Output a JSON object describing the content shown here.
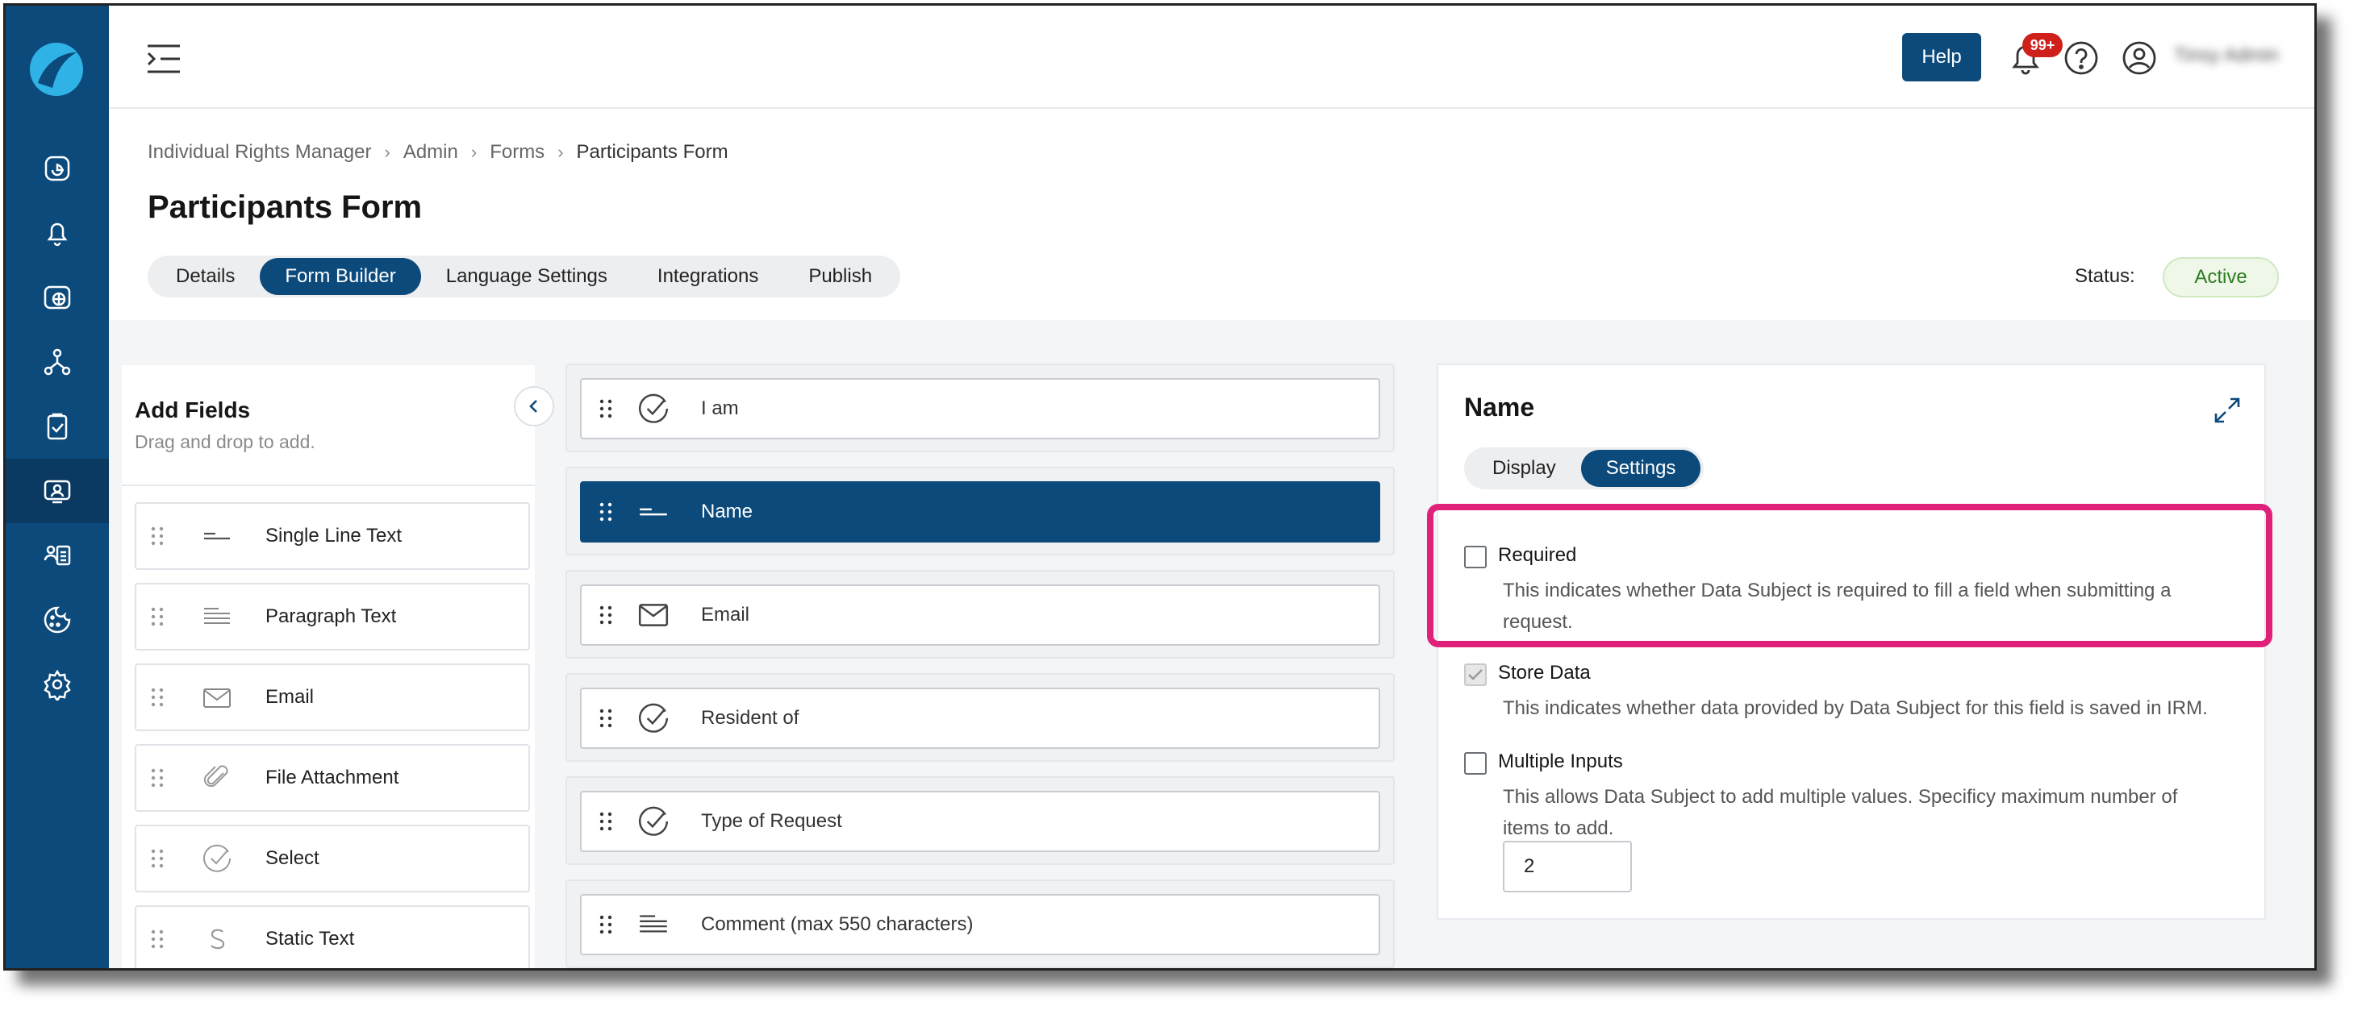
{
  "topbar": {
    "help_label": "Help",
    "notif_badge": "99+",
    "user_name": "Tinsy Admin"
  },
  "breadcrumb": [
    "Individual Rights Manager",
    "Admin",
    "Forms",
    "Participants Form"
  ],
  "page": {
    "title": "Participants Form",
    "tabs": [
      "Details",
      "Form Builder",
      "Language Settings",
      "Integrations",
      "Publish"
    ],
    "active_tab": "Form Builder",
    "status_label": "Status:",
    "status_value": "Active"
  },
  "add_fields": {
    "title": "Add Fields",
    "subtitle": "Drag and drop to add.",
    "items": [
      {
        "label": "Single Line Text",
        "icon": "single-line-icon"
      },
      {
        "label": "Paragraph Text",
        "icon": "paragraph-icon"
      },
      {
        "label": "Email",
        "icon": "envelope-icon"
      },
      {
        "label": "File Attachment",
        "icon": "paperclip-icon"
      },
      {
        "label": "Select",
        "icon": "check-circle-icon"
      },
      {
        "label": "Static Text",
        "icon": "static-text-icon"
      }
    ]
  },
  "canvas": {
    "fields": [
      {
        "label": "I am",
        "icon": "check-circle-icon"
      },
      {
        "label": "Name",
        "icon": "single-line-icon",
        "selected": true
      },
      {
        "label": "Email",
        "icon": "envelope-icon"
      },
      {
        "label": "Resident of",
        "icon": "check-circle-icon"
      },
      {
        "label": "Type of Request",
        "icon": "check-circle-icon"
      },
      {
        "label": "Comment (max 550 characters)",
        "icon": "paragraph-icon"
      }
    ]
  },
  "panel": {
    "title": "Name",
    "tabs": [
      "Display",
      "Settings"
    ],
    "active_tab": "Settings",
    "options": [
      {
        "name": "Required",
        "desc": "This indicates whether Data Subject is required to fill a field when submitting a request.",
        "checked": false
      },
      {
        "name": "Store Data",
        "desc": "This indicates whether data provided by Data Subject for this field is saved in IRM.",
        "checked": true
      },
      {
        "name": "Multiple Inputs",
        "desc": "This allows Data Subject to add multiple values. Specificy maximum number of items to add.",
        "checked": false
      }
    ],
    "max_items_value": "2"
  },
  "colors": {
    "brand": "#0c4a7c",
    "highlight": "#e0217a",
    "badge": "#d0201c",
    "active_status": "#2d7d20"
  }
}
